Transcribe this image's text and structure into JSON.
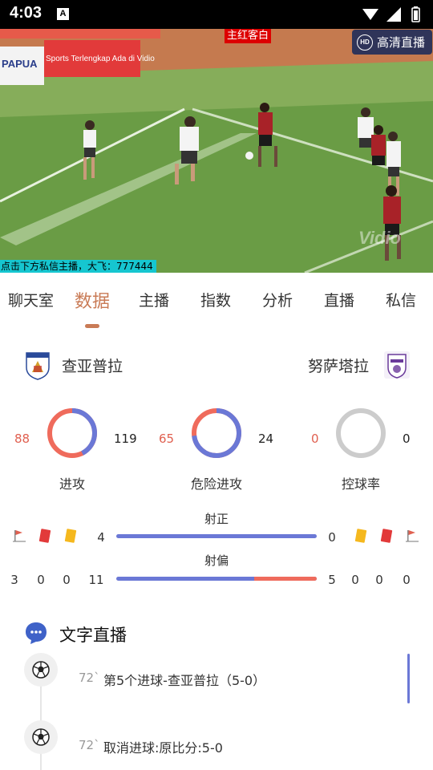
{
  "status_bar": {
    "time": "4:03",
    "notification_letter": "A"
  },
  "video": {
    "live_label": "主红客白",
    "hd_button": {
      "badge": "HD",
      "label": "高清直播"
    },
    "ticker": "点击下方私信主播，大飞：777444",
    "watermark": "Vidio",
    "banner_text": "Sports Terlengkap Ada di Vidio",
    "banner_text_left": "PAPUA"
  },
  "tabs": [
    {
      "label": "聊天室",
      "active": false
    },
    {
      "label": "数据",
      "active": true
    },
    {
      "label": "主播",
      "active": false
    },
    {
      "label": "指数",
      "active": false
    },
    {
      "label": "分析",
      "active": false
    },
    {
      "label": "直播",
      "active": false
    },
    {
      "label": "私信",
      "active": false
    }
  ],
  "teams": {
    "home": "查亚普拉",
    "away": "努萨塔拉"
  },
  "circles": [
    {
      "label": "进攻",
      "home": "88",
      "away": "119",
      "home_fraction": 0.425
    },
    {
      "label": "危险进攻",
      "home": "65",
      "away": "24",
      "home_fraction": 0.73
    },
    {
      "label": "控球率",
      "home": "0",
      "away": "0",
      "home_fraction": 0
    }
  ],
  "bars": [
    {
      "title": "射正",
      "home_value": "4",
      "away_value": "0",
      "away_fraction": 0,
      "home_icons": [
        "corner-flag-icon",
        "red-card-icon",
        "yellow-card-icon"
      ],
      "away_icons": [
        "yellow-card-icon",
        "red-card-icon",
        "corner-flag-icon"
      ]
    },
    {
      "title": "射偏",
      "home_value": "11",
      "away_value": "5",
      "away_fraction": 0.3125,
      "home_counts": [
        "3",
        "0",
        "0"
      ],
      "away_counts": [
        "0",
        "0",
        "0"
      ]
    }
  ],
  "live_text": {
    "title": "文字直播",
    "events": [
      {
        "minute": "72`",
        "text": "第5个进球-查亚普拉（5-0）"
      },
      {
        "minute": "72`",
        "text": "取消进球:原比分:5-0"
      }
    ]
  },
  "colors": {
    "accent": "#c97b56",
    "home": "#6b78d6",
    "away": "#ef6b5c",
    "neutral": "#cccccc"
  }
}
